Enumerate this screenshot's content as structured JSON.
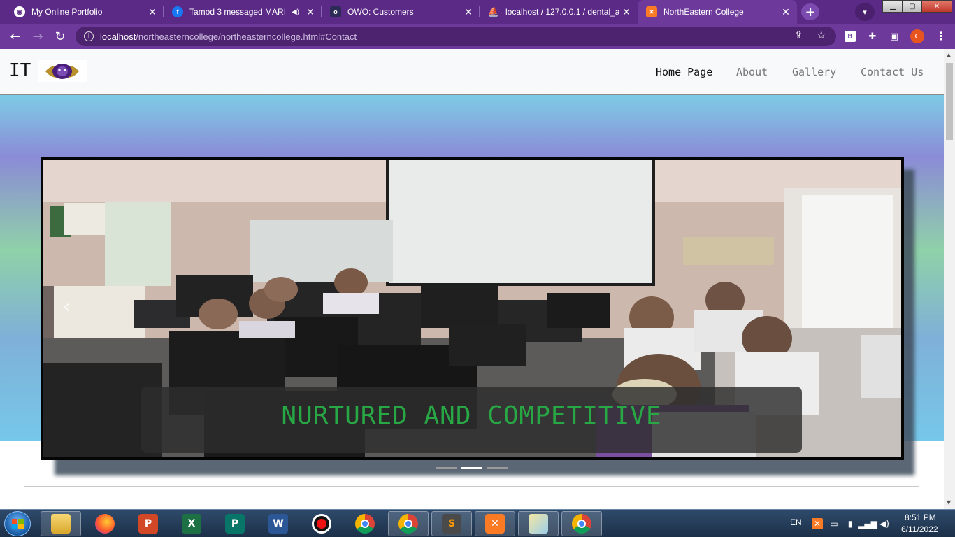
{
  "browser": {
    "tabs": [
      {
        "title": "My Online Portfolio",
        "favicon": "globe-icon",
        "active": false
      },
      {
        "title": "Tamod 3 messaged MARI",
        "favicon": "facebook-icon",
        "active": false,
        "muted_audio": true
      },
      {
        "title": "OWO: Customers",
        "favicon": "owo-icon",
        "active": false
      },
      {
        "title": "localhost / 127.0.0.1 / dental_a",
        "favicon": "phpmyadmin-icon",
        "active": false
      },
      {
        "title": "NorthEastern College",
        "favicon": "xampp-icon",
        "active": true
      }
    ],
    "url_host": "localhost",
    "url_path": "/northeasterncollege/northeasterncollege.html#Contact",
    "profile_initial": "C",
    "extension_b": "B"
  },
  "site": {
    "brand": "IT",
    "nav": [
      {
        "label": "Home Page",
        "active": true
      },
      {
        "label": "About",
        "active": false
      },
      {
        "label": "Gallery",
        "active": false
      },
      {
        "label": "Contact Us",
        "active": false
      }
    ],
    "carousel": {
      "caption": "NURTURED AND COMPETITIVE",
      "slide_count": 3,
      "active_slide": 2
    }
  },
  "taskbar": {
    "apps": [
      "file-explorer-icon",
      "firefox-icon",
      "powerpoint-icon",
      "excel-icon",
      "publisher-icon",
      "word-icon",
      "recorder-icon",
      "chrome-icon",
      "chrome-profile-icon",
      "sublime-icon",
      "xampp-icon",
      "paint-icon",
      "chrome-alt-icon"
    ],
    "language": "EN",
    "time": "8:51 PM",
    "date": "6/11/2022"
  },
  "colors": {
    "tab_strip": "#5b2a86",
    "toolbar": "#6d3a9c",
    "caption_text": "#28a745"
  }
}
